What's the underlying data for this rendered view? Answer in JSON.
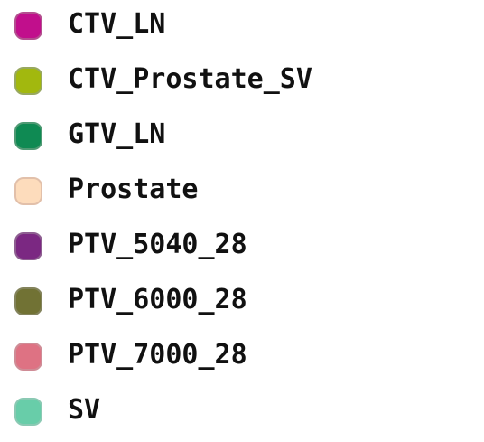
{
  "structures": [
    {
      "name": "CTV_LN",
      "color": "#c10f8c",
      "border": "#b3508f",
      "icon": "color-swatch-icon"
    },
    {
      "name": "CTV_Prostate_SV",
      "color": "#a2b80e",
      "border": "#98a860",
      "icon": "color-swatch-icon"
    },
    {
      "name": "GTV_LN",
      "color": "#0f8a53",
      "border": "#4f9a74",
      "icon": "color-swatch-icon"
    },
    {
      "name": "Prostate",
      "color": "#fddcbc",
      "border": "#e2c0aa",
      "icon": "color-swatch-icon"
    },
    {
      "name": "PTV_5040_28",
      "color": "#7b2882",
      "border": "#8e5f91",
      "icon": "color-swatch-icon"
    },
    {
      "name": "PTV_6000_28",
      "color": "#717234",
      "border": "#83835c",
      "icon": "color-swatch-icon"
    },
    {
      "name": "PTV_7000_28",
      "color": "#de7283",
      "border": "#cf8c96",
      "icon": "color-swatch-icon"
    },
    {
      "name": "SV",
      "color": "#68cda9",
      "border": "#8ac9b3",
      "icon": "color-swatch-icon"
    }
  ]
}
